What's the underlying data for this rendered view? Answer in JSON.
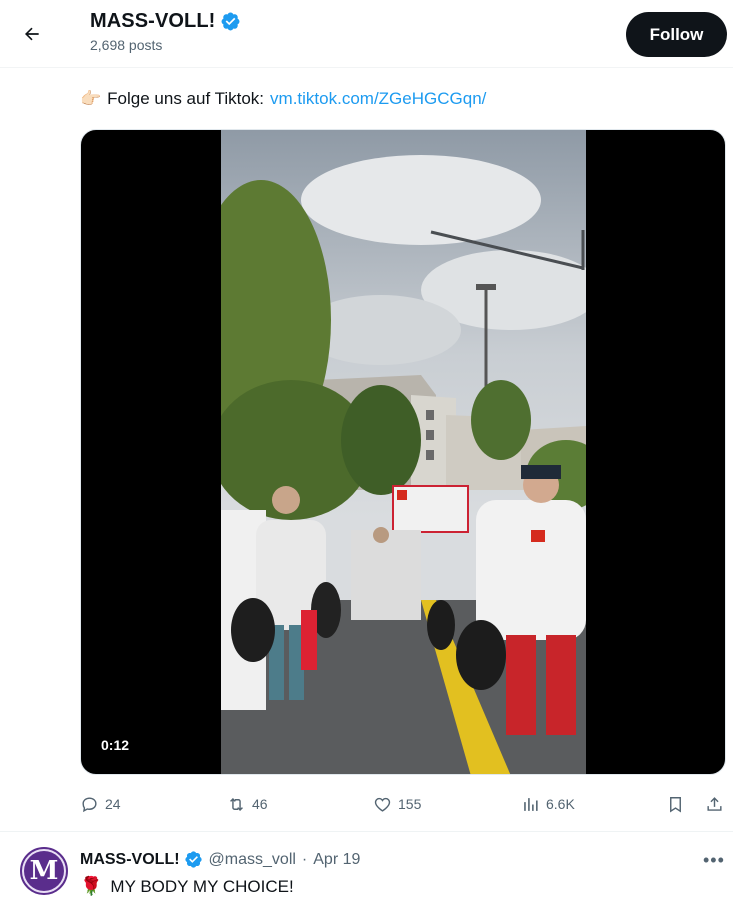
{
  "header": {
    "back_icon": "arrow-left-icon",
    "title": "MASS-VOLL!",
    "posts": "2,698 posts",
    "follow_label": "Follow",
    "verified_color": "#1d9bf0"
  },
  "tweet": {
    "text_prefix": "Folge uns auf Tiktok:",
    "link": "vm.tiktok.com/ZGeHGCGqn/",
    "emoji": "👉🏻",
    "video_time": "0:12",
    "actions": {
      "reply_count": "24",
      "repost_count": "46",
      "like_count": "155",
      "views_count": "6.6K"
    }
  },
  "next_tweet": {
    "name": "MASS-VOLL!",
    "handle": "@mass_voll",
    "separator": "·",
    "date": "Apr 19",
    "more": "•••",
    "emoji": "🌹",
    "text": "MY BODY MY CHOICE!",
    "avatar_letter": "M"
  },
  "colors": {
    "accent": "#1d9bf0",
    "text": "#0f1419",
    "muted": "#536471",
    "follow_bg": "#0f1419"
  }
}
